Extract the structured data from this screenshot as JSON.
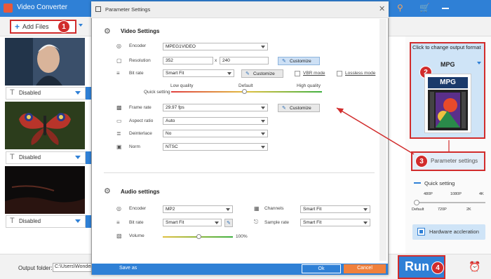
{
  "app": {
    "title": "Video Converter"
  },
  "toolbar": {
    "add_files_label": "Add Files"
  },
  "badges": {
    "b1": "1",
    "b2": "2",
    "b3": "3",
    "b4": "4"
  },
  "items": [
    {
      "subtitle": "Disabled"
    },
    {
      "subtitle": "Disabled"
    },
    {
      "subtitle": "Disabled"
    }
  ],
  "dialog": {
    "title": "Parameter Settings",
    "video_section": "Video Settings",
    "encoder_label": "Encoder",
    "encoder_value": "MPEG1VIDEO",
    "resolution_label": "Resolution",
    "res_w": "352",
    "res_x": "x",
    "res_h": "240",
    "customize": "Customize",
    "bitrate_label": "Bit rate",
    "bitrate_value": "Smart Fit",
    "vbr_label": "VBR mode",
    "lossless_label": "Lossless mode",
    "low_quality": "Low quality",
    "default_label": "Default",
    "high_quality": "High quality",
    "quick_setting": "Quick setting",
    "framerate_label": "Frame rate",
    "framerate_value": "29.97 fps",
    "aspect_label": "Aspect ratio",
    "aspect_value": "Auto",
    "deinterlace_label": "Deinterlace",
    "deinterlace_value": "No",
    "norm_label": "Norm",
    "norm_value": "NTSC",
    "audio_section": "Audio settings",
    "a_encoder_label": "Encoder",
    "a_encoder_value": "MP2",
    "a_bitrate_label": "Bit rate",
    "a_bitrate_value": "Smart Fit",
    "volume_label": "Volume",
    "volume_value": "100%",
    "channels_label": "Channels",
    "channels_value": "Smart Fit",
    "samplerate_label": "Sample rate",
    "samplerate_value": "Smart Fit",
    "save_as": "Save as",
    "ok": "Ok",
    "cancel": "Cancel"
  },
  "format": {
    "caption": "Click to change output format",
    "name": "MPG",
    "icon_text": "MPG",
    "param_settings": "Parameter settings",
    "quick_setting": "Quick setting",
    "q_480": "480P",
    "q_1080": "1080P",
    "q_4k": "4K",
    "q_default": "Default",
    "q_720": "720P",
    "q_2k": "2K",
    "hw_accel": "Hardware accleration"
  },
  "bottom": {
    "output_folder_label": "Output folder:",
    "output_path": "C:\\Users\\WonderF",
    "run": "Run"
  },
  "colors": {
    "accent": "#2f80d6",
    "highlight": "#d12c2c",
    "cancel": "#f0803c"
  }
}
